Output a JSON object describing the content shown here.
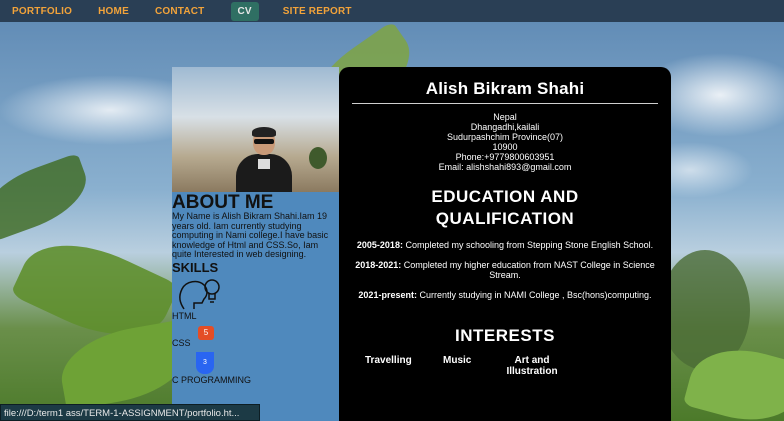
{
  "nav": {
    "items": [
      {
        "label": "PORTFOLIO"
      },
      {
        "label": "HOME"
      },
      {
        "label": "CONTACT"
      },
      {
        "label": "CV"
      },
      {
        "label": "SITE REPORT"
      }
    ],
    "active": "CV",
    "colors": {
      "bar": "#2a3f55",
      "link": "#f2a33a",
      "active_bg": "#2f6f63"
    }
  },
  "about": {
    "title": "ABOUT ME",
    "text": "My Name is Alish Bikram Shahi.Iam 19 years old. Iam currently studying computing in Nami college.I have basic knowledge of Html and CSS.So, Iam quite Interested in web designing."
  },
  "skills": {
    "title": "SKILLS",
    "items": [
      {
        "label": "HTML",
        "icon": "lightbulb-head-icon"
      },
      {
        "label": "CSS",
        "icon": "html5-icon"
      },
      {
        "label": "C PROGRAMMING",
        "icon": "css3-icon"
      }
    ]
  },
  "cv": {
    "name": "Alish Bikram Shahi",
    "contact": [
      "Nepal",
      "Dhangadhi,kailali",
      "Sudurpashchim Province(07)",
      "10900",
      "Phone:+9779800603951",
      "Email: alishshahi893@gmail.com"
    ],
    "education_title_1": "EDUCATION AND",
    "education_title_2": "QUALIFICATION",
    "education": [
      {
        "period": "2005-2018:",
        "text": " Completed my schooling from Stepping Stone English School."
      },
      {
        "period": "2018-2021:",
        "text": " Completed my higher education from NAST College in Science Stream."
      },
      {
        "period": "2021-present:",
        "text": " Currently studying in NAMI College , Bsc(hons)computing."
      }
    ],
    "interests_title": "INTERESTS",
    "interests": [
      "Travelling",
      "Music",
      "Art and Illustration"
    ]
  },
  "status_bar": {
    "url": "file:///D:/term1 ass/TERM-1-ASSIGNMENT/portfolio.ht..."
  }
}
